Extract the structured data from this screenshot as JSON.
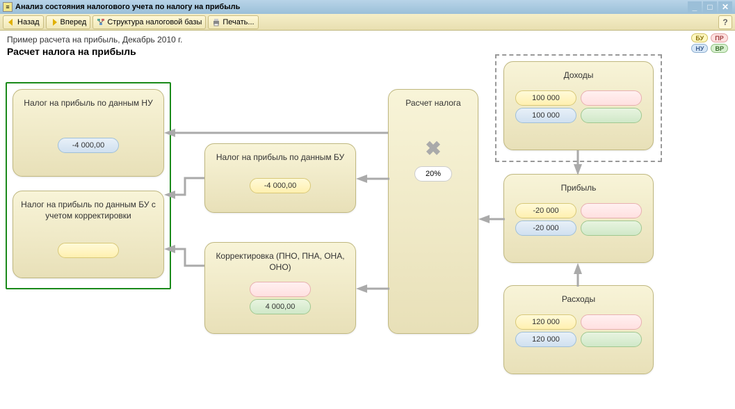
{
  "window": {
    "title": "Анализ состояния налогового учета по налогу на прибыль"
  },
  "toolbar": {
    "back": "Назад",
    "forward": "Вперед",
    "structure": "Структура налоговой базы",
    "print": "Печать..."
  },
  "header": {
    "subinfo": "Пример расчета на прибыль, Декабрь 2010 г.",
    "title": "Расчет налога на прибыль"
  },
  "legend": {
    "bu": "БУ",
    "pr": "ПР",
    "nu": "НУ",
    "vr": "ВР"
  },
  "nodes": {
    "tax_nu": {
      "title": "Налог на прибыль по данным НУ",
      "val": "-4 000,00"
    },
    "tax_bu_corr": {
      "title": "Налог на прибыль по данным БУ с учетом корректировки",
      "val": ""
    },
    "tax_bu": {
      "title": "Налог на прибыль по данным БУ",
      "val": "-4 000,00"
    },
    "corr": {
      "title": "Корректировка (ПНО, ПНА, ОНА, ОНО)",
      "pink": "",
      "green": "4 000,00"
    },
    "calc": {
      "title": "Расчет налога",
      "rate": "20%"
    },
    "income": {
      "title": "Доходы",
      "bu": "100 000",
      "pr": "",
      "nu": "100 000",
      "vr": ""
    },
    "profit": {
      "title": "Прибыль",
      "bu": "-20 000",
      "pr": "",
      "nu": "-20 000",
      "vr": ""
    },
    "expense": {
      "title": "Расходы",
      "bu": "120 000",
      "pr": "",
      "nu": "120 000",
      "vr": ""
    }
  }
}
